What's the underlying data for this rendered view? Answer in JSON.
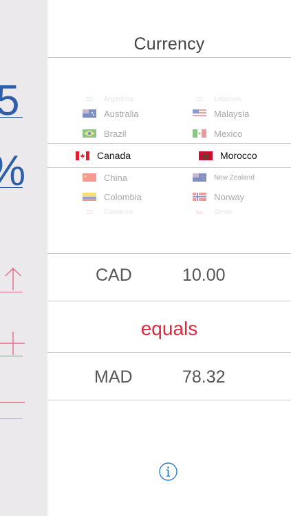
{
  "side": {
    "digit": "5",
    "percent": "%"
  },
  "title": "Currency",
  "picker": {
    "left": [
      {
        "name": "Argentina",
        "state": "faint"
      },
      {
        "name": "Australia",
        "state": "normal"
      },
      {
        "name": "Brazil",
        "state": "normal"
      },
      {
        "name": "Canada",
        "state": "selected"
      },
      {
        "name": "China",
        "state": "normal"
      },
      {
        "name": "Colombia",
        "state": "normal"
      },
      {
        "name": "Costarica",
        "state": "faint"
      }
    ],
    "right": [
      {
        "name": "Lebanon",
        "state": "faint"
      },
      {
        "name": "Malaysia",
        "state": "normal"
      },
      {
        "name": "Mexico",
        "state": "normal"
      },
      {
        "name": "Morocco",
        "state": "selected"
      },
      {
        "name": "New Zealand",
        "state": "normal"
      },
      {
        "name": "Norway",
        "state": "normal"
      },
      {
        "name": "Oman",
        "state": "faint"
      }
    ]
  },
  "from": {
    "code": "CAD",
    "amount": "10.00"
  },
  "equals_label": "equals",
  "to": {
    "code": "MAD",
    "amount": "78.32"
  },
  "colors": {
    "side_blue": "#2f5ea8",
    "side_pink": "#e56b86",
    "equals_red": "#e0283c",
    "info_blue": "#2a7fd4"
  },
  "icons": [
    "arrow-up-icon",
    "plus-icon",
    "minus-icon",
    "info-icon"
  ]
}
